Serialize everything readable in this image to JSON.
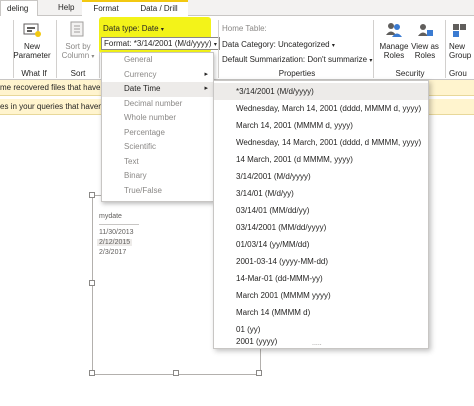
{
  "tabs": [
    "deling",
    "Help",
    "Format",
    "Data / Drill"
  ],
  "ribbon": {
    "new_parameter": [
      "New",
      "Parameter"
    ],
    "sort_by_column": [
      "Sort by",
      "Column"
    ],
    "group_whatif": "What If",
    "group_sort": "Sort",
    "data_type": "Data type: Date",
    "format": "Format: *3/14/2001 (M/d/yyyy)",
    "home_table": "Home Table:",
    "data_category": "Data Category: Uncategorized",
    "default_summarization": "Default Summarization: Don't summarize",
    "group_properties": "Properties",
    "manage_roles": [
      "Manage",
      "Roles"
    ],
    "view_as_roles": [
      "View as",
      "Roles"
    ],
    "group_security": "Security",
    "new_group": [
      "New",
      "Group"
    ],
    "group_groups": "Grou"
  },
  "notifications": [
    "me recovered files that haven'",
    "es in your queries that haven'"
  ],
  "format_menu": {
    "items": [
      "General",
      "Currency",
      "Date Time",
      "Decimal number",
      "Whole number",
      "Percentage",
      "Scientific",
      "Text",
      "Binary",
      "True/False"
    ],
    "active": "Date Time"
  },
  "datetime_menu": {
    "items": [
      "*3/14/2001 (M/d/yyyy)",
      "Wednesday, March 14, 2001 (dddd, MMMM d, yyyy)",
      "March 14, 2001 (MMMM d, yyyy)",
      "Wednesday, 14 March, 2001 (dddd, d MMMM, yyyy)",
      "14 March, 2001 (d MMMM, yyyy)",
      "3/14/2001 (M/d/yyyy)",
      "3/14/01 (M/d/yy)",
      "03/14/01 (MM/dd/yy)",
      "03/14/2001 (MM/dd/yyyy)",
      "01/03/14 (yy/MM/dd)",
      "2001-03-14 (yyyy-MM-dd)",
      "14-Mar-01 (dd-MMM-yy)",
      "March 2001 (MMMM yyyy)",
      "March 14 (MMMM d)",
      "01 (yy)",
      "2001 (yyyy)"
    ],
    "selected": "*3/14/2001 (M/d/yyyy)",
    "footer": "....."
  },
  "table": {
    "header": "mydate",
    "rows": [
      "11/30/2013",
      "2/12/2015",
      "2/3/2017"
    ]
  },
  "colors": {
    "highlight": "#f2f200",
    "notification_bg": "#fff4ce",
    "menu_hover": "#edebe9"
  }
}
